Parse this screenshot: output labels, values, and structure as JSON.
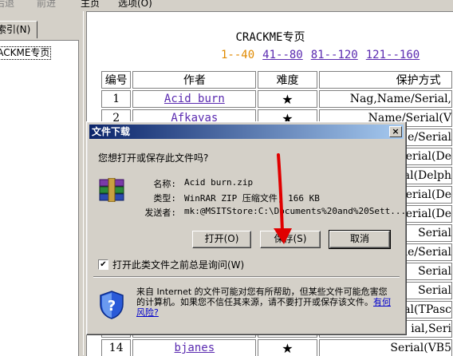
{
  "menubar": {
    "back": "后退",
    "forward": "前进",
    "home": "主页",
    "favorites": "选项(O)"
  },
  "left_pane": {
    "tab_label": "索引(N)",
    "selected_item": "CRACKME专页"
  },
  "page": {
    "title": "CRACKME专页",
    "nav": {
      "current": "1--40",
      "links": [
        "41--80",
        "81--120",
        "121--160"
      ]
    },
    "table": {
      "headers": [
        "编号",
        "作者",
        "难度",
        "保护方式"
      ],
      "rows": [
        {
          "num": "1",
          "author": "Acid burn",
          "difficulty": "★",
          "protection": "Nag,Name/Serial,"
        },
        {
          "num": "2",
          "author": "Afkayas",
          "difficulty": "★",
          "protection": "Name/Serial(V"
        },
        {
          "num": "",
          "author": "",
          "difficulty": "",
          "protection": "e/Serial"
        },
        {
          "num": "",
          "author": "",
          "difficulty": "",
          "protection": "Serial(De"
        },
        {
          "num": "",
          "author": "",
          "difficulty": "",
          "protection": "ial(Delph"
        },
        {
          "num": "",
          "author": "",
          "difficulty": "",
          "protection": "Serial(De"
        },
        {
          "num": "",
          "author": "",
          "difficulty": "",
          "protection": "Serial(De"
        },
        {
          "num": "",
          "author": "",
          "difficulty": "",
          "protection": "Serial"
        },
        {
          "num": "",
          "author": "",
          "difficulty": "",
          "protection": "me/Serial"
        },
        {
          "num": "",
          "author": "",
          "difficulty": "",
          "protection": "Serial"
        },
        {
          "num": "",
          "author": "",
          "difficulty": "",
          "protection": "Serial"
        },
        {
          "num": "",
          "author": "",
          "difficulty": "",
          "protection": "ial(TPasc"
        },
        {
          "num": "",
          "author": "",
          "difficulty": "",
          "protection": "ial,Seri"
        },
        {
          "num": "14",
          "author": "bjanes",
          "difficulty": "★",
          "protection": "Serial(VB5"
        }
      ]
    }
  },
  "dialog": {
    "title": "文件下载",
    "close_glyph": "×",
    "question": "您想打开或保存此文件吗?",
    "name_label": "名称:",
    "name_value": "Acid burn.zip",
    "type_label": "类型:",
    "type_value": "WinRAR ZIP 压缩文件, 166 KB",
    "sender_label": "发送者:",
    "sender_value": "mk:@MSITStore:C:\\Documents%20and%20Sett...",
    "open_button": "打开(O)",
    "save_button": "保存(S)",
    "cancel_button": "取消",
    "checkbox_checked": "✔",
    "checkbox_label": "打开此类文件之前总是询问(W)",
    "warning_text": "来自 Internet 的文件可能对您有所帮助，但某些文件可能危害您的计算机。如果您不信任其来源，请不要打开或保存该文件。",
    "warning_link": "有何风险?"
  },
  "colors": {
    "titlebar_start": "#0a246a",
    "titlebar_end": "#a6caf0",
    "link": "#5a2ab0",
    "nav_current": "#e08a00",
    "arrow": "#e00000"
  }
}
